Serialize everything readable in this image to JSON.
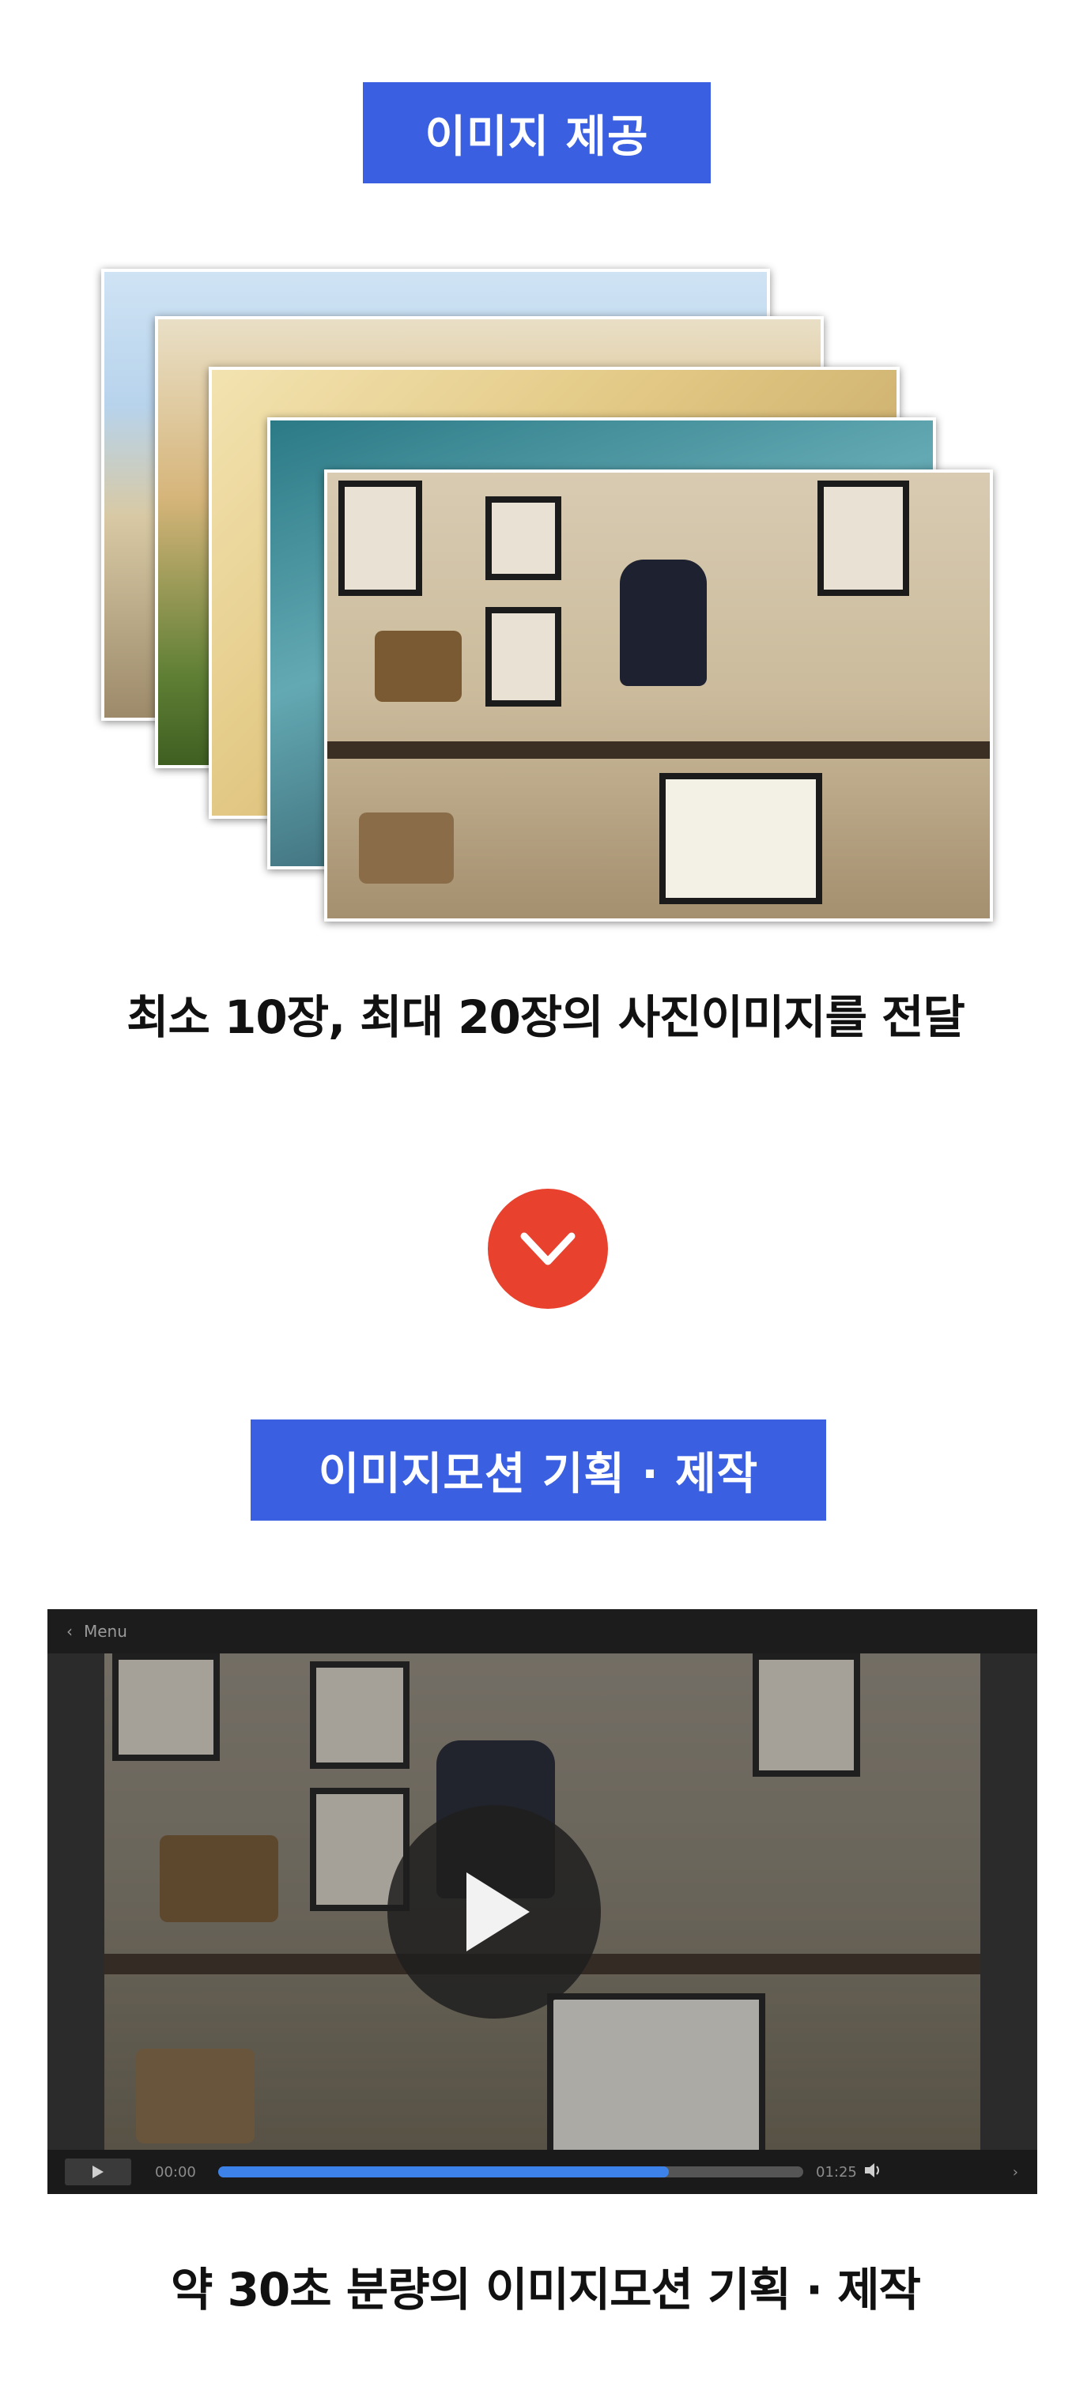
{
  "section1": {
    "badge": "이미지 제공",
    "caption": "최소 10장, 최대 20장의 사진이미지를 전달"
  },
  "section2": {
    "badge": "이미지모션 기획 · 제작",
    "caption": "약 30초 분량의 이미지모션 기획 · 제작"
  },
  "player": {
    "menu_label": "Menu",
    "time_start": "00:00",
    "time_end": "01:25",
    "progress": 0.77
  },
  "colors": {
    "badge": "#3a5fe0",
    "arrow_circle": "#e8412e",
    "progress_fill": "#3d82e8"
  },
  "icons": [
    "chevron-down-icon",
    "play-icon",
    "back-icon",
    "volume-icon",
    "next-icon"
  ]
}
